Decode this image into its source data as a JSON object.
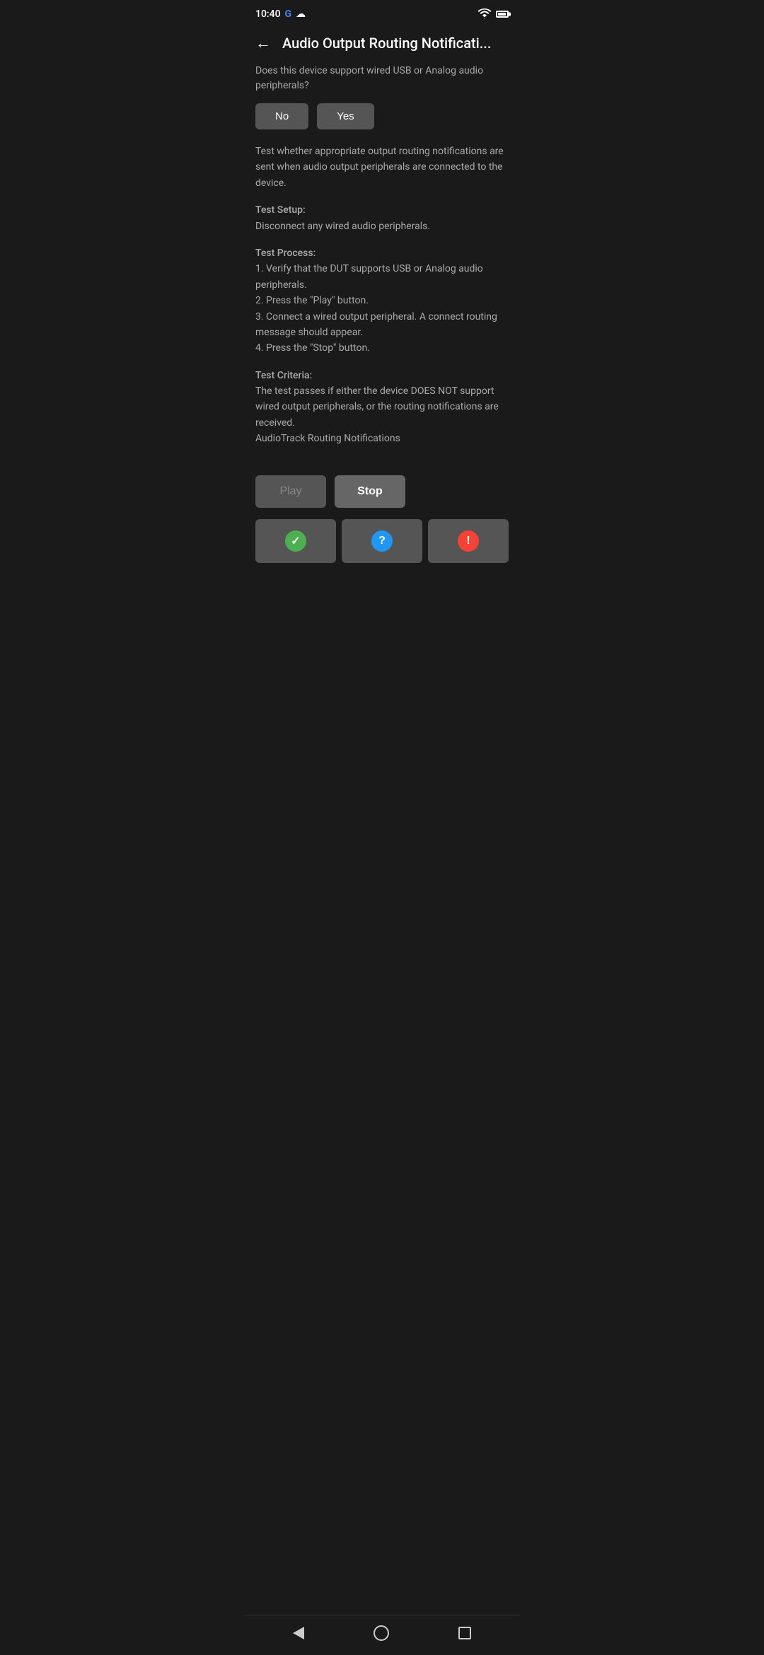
{
  "status_bar": {
    "time": "10:40",
    "google_label": "G",
    "cloud_label": "☁"
  },
  "header": {
    "back_label": "←",
    "title": "Audio Output Routing Notificati..."
  },
  "question": {
    "text": "Does this device support wired USB or Analog audio peripherals?"
  },
  "buttons": {
    "no_label": "No",
    "yes_label": "Yes"
  },
  "description": {
    "text": "Test whether appropriate output routing notifications are sent when audio output peripherals are connected to the device."
  },
  "test_setup": {
    "label": "Test Setup:",
    "content": "Disconnect any wired audio peripherals."
  },
  "test_process": {
    "label": "Test Process:",
    "steps": "1. Verify that the DUT supports USB or Analog audio peripherals.\n2. Press the \"Play\" button.\n3. Connect a wired output peripheral. A connect routing message should appear.\n4. Press the \"Stop\" button."
  },
  "test_criteria": {
    "label": "Test Criteria:",
    "content": "The test passes if either the device DOES NOT support wired output peripherals, or the routing notifications are received.\nAudioTrack Routing Notifications"
  },
  "controls": {
    "play_label": "Play",
    "stop_label": "Stop"
  },
  "result_buttons": {
    "pass_icon": "✓",
    "info_icon": "?",
    "fail_icon": "!"
  },
  "nav": {
    "back_label": "back",
    "home_label": "home",
    "recents_label": "recents"
  }
}
